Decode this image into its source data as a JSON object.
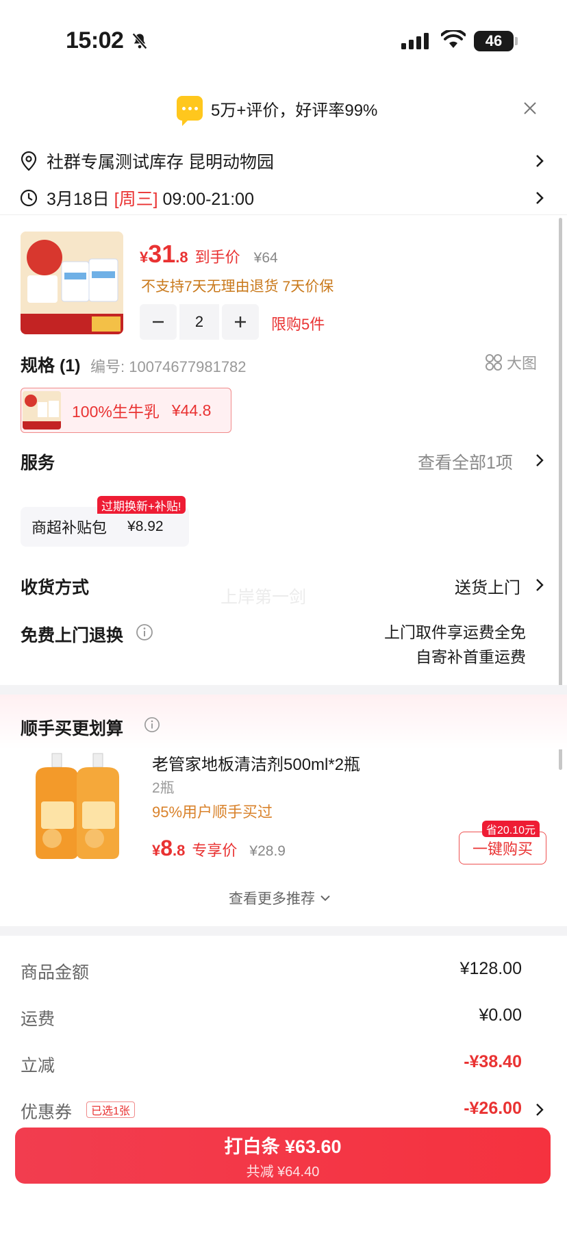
{
  "status_bar": {
    "time": "15:02",
    "battery": "46"
  },
  "review_banner": {
    "text": "5万+评价，好评率99%"
  },
  "address": {
    "text": "社群专属测试库存  昆明动物园"
  },
  "delivery_time": {
    "date": "3月18日",
    "weekday": "[周三]",
    "range": "09:00-21:00"
  },
  "product": {
    "price_yen": "¥",
    "price_int": "31",
    "price_dec": ".8",
    "price_label": "到手价",
    "original_price": "¥64",
    "policy": "不支持7天无理由退货  7天价保",
    "quantity": "2",
    "limit": "限购5件"
  },
  "spec": {
    "title": "规格 (1)",
    "code": "编号: 10074677981782",
    "big_pic": "大图",
    "option_label": "100%生牛乳",
    "option_price": "¥44.8"
  },
  "service": {
    "title": "服务",
    "view_all": "查看全部1项",
    "card_name": "商超补贴包",
    "card_price": "¥8.92",
    "card_tag": "过期换新+补贴!"
  },
  "delivery_method": {
    "title": "收货方式",
    "value": "送货上门"
  },
  "free_return": {
    "title": "免费上门退换",
    "line1": "上门取件享运费全免",
    "line2": "自寄补首重运费"
  },
  "watermark": "上岸第一剑",
  "recommend": {
    "title": "顺手买更划算",
    "name": "老管家地板清洁剂500ml*2瓶",
    "qty": "2瓶",
    "buyers": "95%用户顺手买过",
    "price_yen": "¥",
    "price_int": "8",
    "price_dec": ".8",
    "price_label": "专享价",
    "original_price": "¥28.9",
    "save_tag": "省20.10元",
    "buy_button": "一键购买",
    "more": "查看更多推荐"
  },
  "summary": {
    "goods_label": "商品金额",
    "goods_value": "¥128.00",
    "shipping_label": "运费",
    "shipping_value": "¥0.00",
    "discount_label": "立减",
    "discount_value": "-¥38.40",
    "coupon_label": "优惠券",
    "coupon_tag": "已选1张",
    "coupon_value": "-¥26.00"
  },
  "pay_button": {
    "main": "打白条 ¥63.60",
    "sub": "共减 ¥64.40"
  },
  "colors": {
    "accent": "#e93232",
    "policy": "#c9791b",
    "tag": "#ee1c34"
  }
}
